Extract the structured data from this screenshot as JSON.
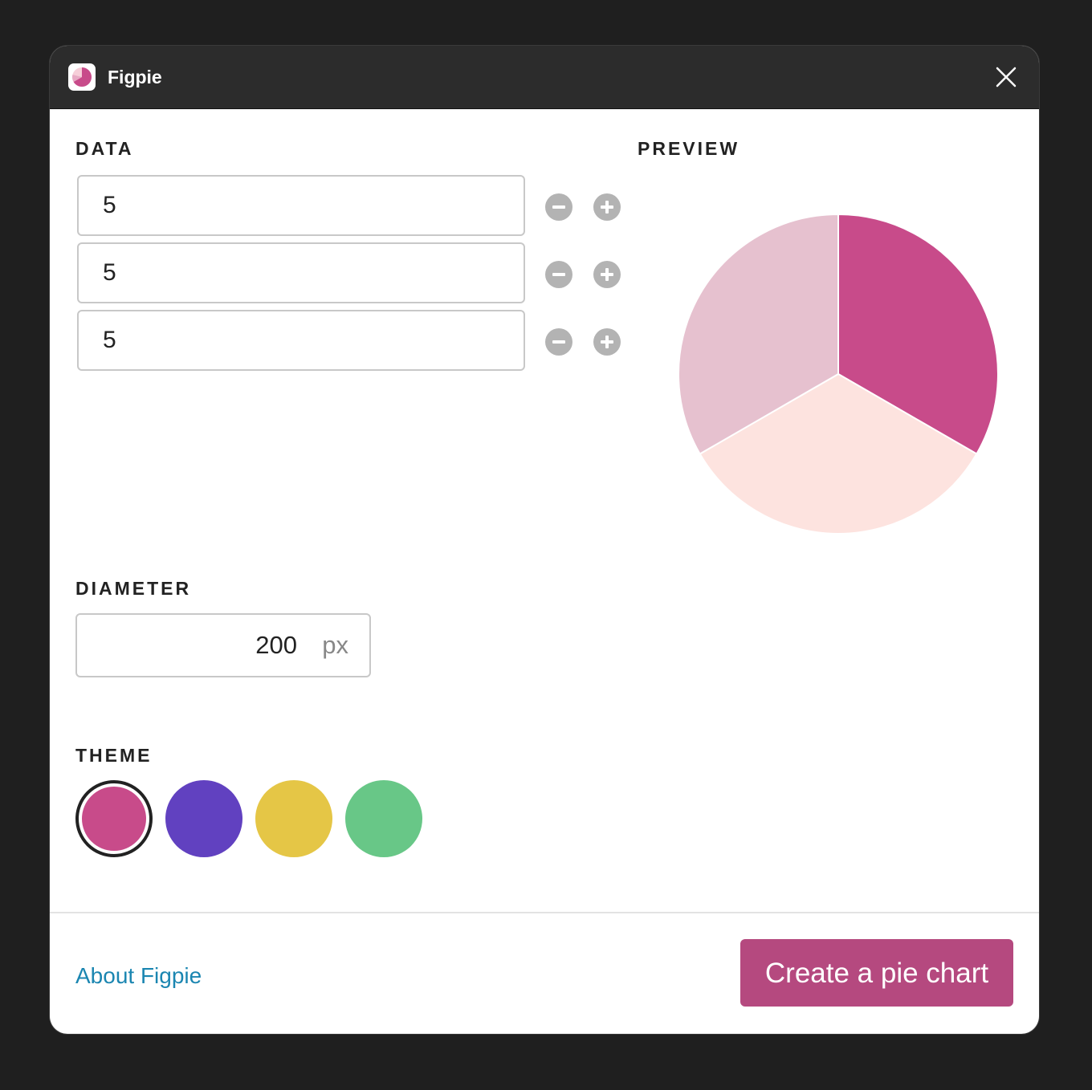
{
  "app": {
    "title": "Figpie",
    "icon": "figpie-logo-icon",
    "close_icon": "close-icon"
  },
  "data_section": {
    "label": "DATA",
    "rows": [
      {
        "value": "5"
      },
      {
        "value": "5"
      },
      {
        "value": "5"
      }
    ],
    "remove_icon": "minus-circle-icon",
    "add_icon": "plus-circle-icon"
  },
  "preview": {
    "label": "PREVIEW"
  },
  "chart_data": {
    "type": "pie",
    "values": [
      5,
      5,
      5
    ],
    "colors": [
      "#c84b8a",
      "#fde3df",
      "#e6c1cf"
    ],
    "start_angle_deg": 0,
    "direction": "clockwise"
  },
  "diameter": {
    "label": "DIAMETER",
    "value": "200",
    "unit": "px"
  },
  "theme": {
    "label": "THEME",
    "options": [
      {
        "color": "#c84b8a",
        "selected": true
      },
      {
        "color": "#6141c0",
        "selected": false
      },
      {
        "color": "#e5c646",
        "selected": false
      },
      {
        "color": "#68c787",
        "selected": false
      }
    ]
  },
  "footer": {
    "about_link": "About Figpie",
    "create_button": "Create a pie chart"
  },
  "colors": {
    "accent": "#b5497f",
    "link": "#1b86b1",
    "titlebar": "#2c2c2c"
  }
}
